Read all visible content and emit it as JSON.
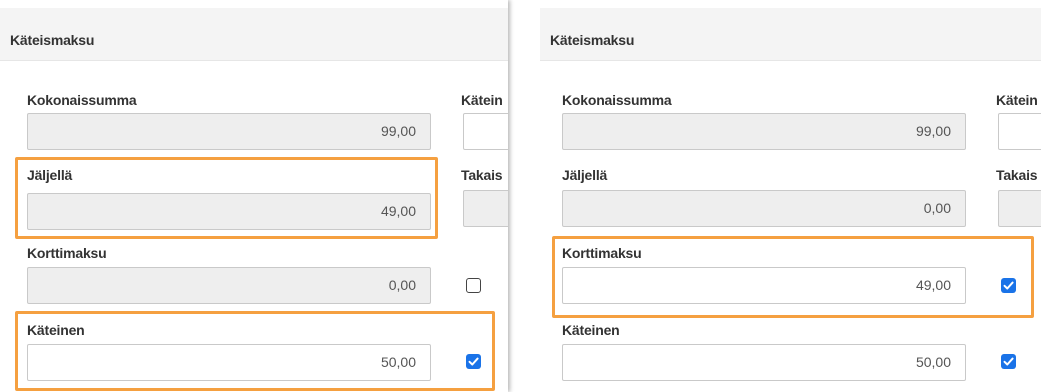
{
  "left_panel": {
    "title": "Käteismaksu",
    "kokonaissumma": {
      "label": "Kokonaissumma",
      "value": "99,00"
    },
    "jaljella": {
      "label": "Jäljellä",
      "value": "49,00"
    },
    "korttimaksu": {
      "label": "Korttimaksu",
      "value": "0,00",
      "checked": false
    },
    "kateinen": {
      "label": "Käteinen",
      "value": "50,00",
      "checked": true
    },
    "right_col_label_1": "Kätein",
    "right_col_label_2": "Takais"
  },
  "right_panel": {
    "title": "Käteismaksu",
    "kokonaissumma": {
      "label": "Kokonaissumma",
      "value": "99,00"
    },
    "jaljella": {
      "label": "Jäljellä",
      "value": "0,00"
    },
    "korttimaksu": {
      "label": "Korttimaksu",
      "value": "49,00",
      "checked": true
    },
    "kateinen": {
      "label": "Käteinen",
      "value": "50,00",
      "checked": true
    },
    "right_col_label_1": "Kätein",
    "right_col_label_2": "Takais"
  },
  "colors": {
    "highlight": "#f5a040",
    "checkbox_checked": "#1a73e8",
    "readonly_bg": "#eeeeee",
    "header_bg": "#f4f4f4"
  }
}
